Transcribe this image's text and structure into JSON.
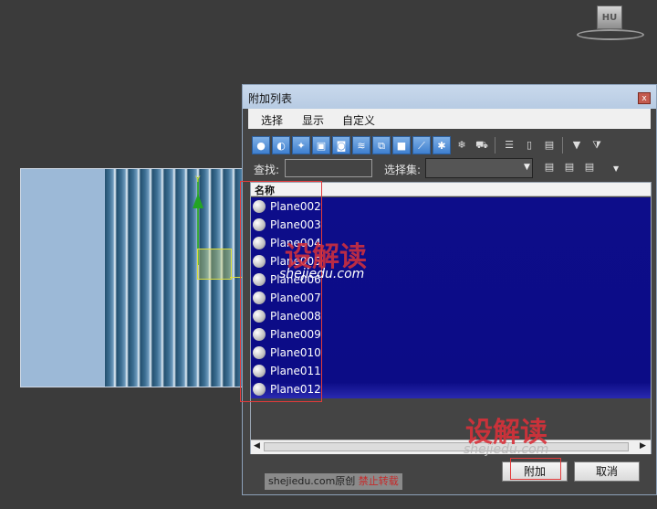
{
  "viewport": {
    "gizmo_label": "Y",
    "viewcube_label": "HU"
  },
  "dialog": {
    "title": "附加列表",
    "close_glyph": "x",
    "menu": [
      "选择",
      "显示",
      "自定义"
    ],
    "find_label": "查找:",
    "find_value": "",
    "selection_set_label": "选择集:",
    "selection_set_value": "",
    "column_header": "名称",
    "objects": [
      "Plane002",
      "Plane003",
      "Plane004",
      "Plane005",
      "Plane006",
      "Plane007",
      "Plane008",
      "Plane009",
      "Plane010",
      "Plane011",
      "Plane012"
    ],
    "attach_button": "附加",
    "cancel_button": "取消"
  },
  "watermark": {
    "logo_text": "设解读",
    "site": "shejiedu.com"
  },
  "credit": {
    "site": "shejiedu.com",
    "original": "原创",
    "no_repost": "禁止转载"
  },
  "colors": {
    "list_selection": "#0d0d8a",
    "toolbar_active": "#3e7fcf",
    "highlight_box": "#e23b3b",
    "watermark": "#d8313a"
  }
}
